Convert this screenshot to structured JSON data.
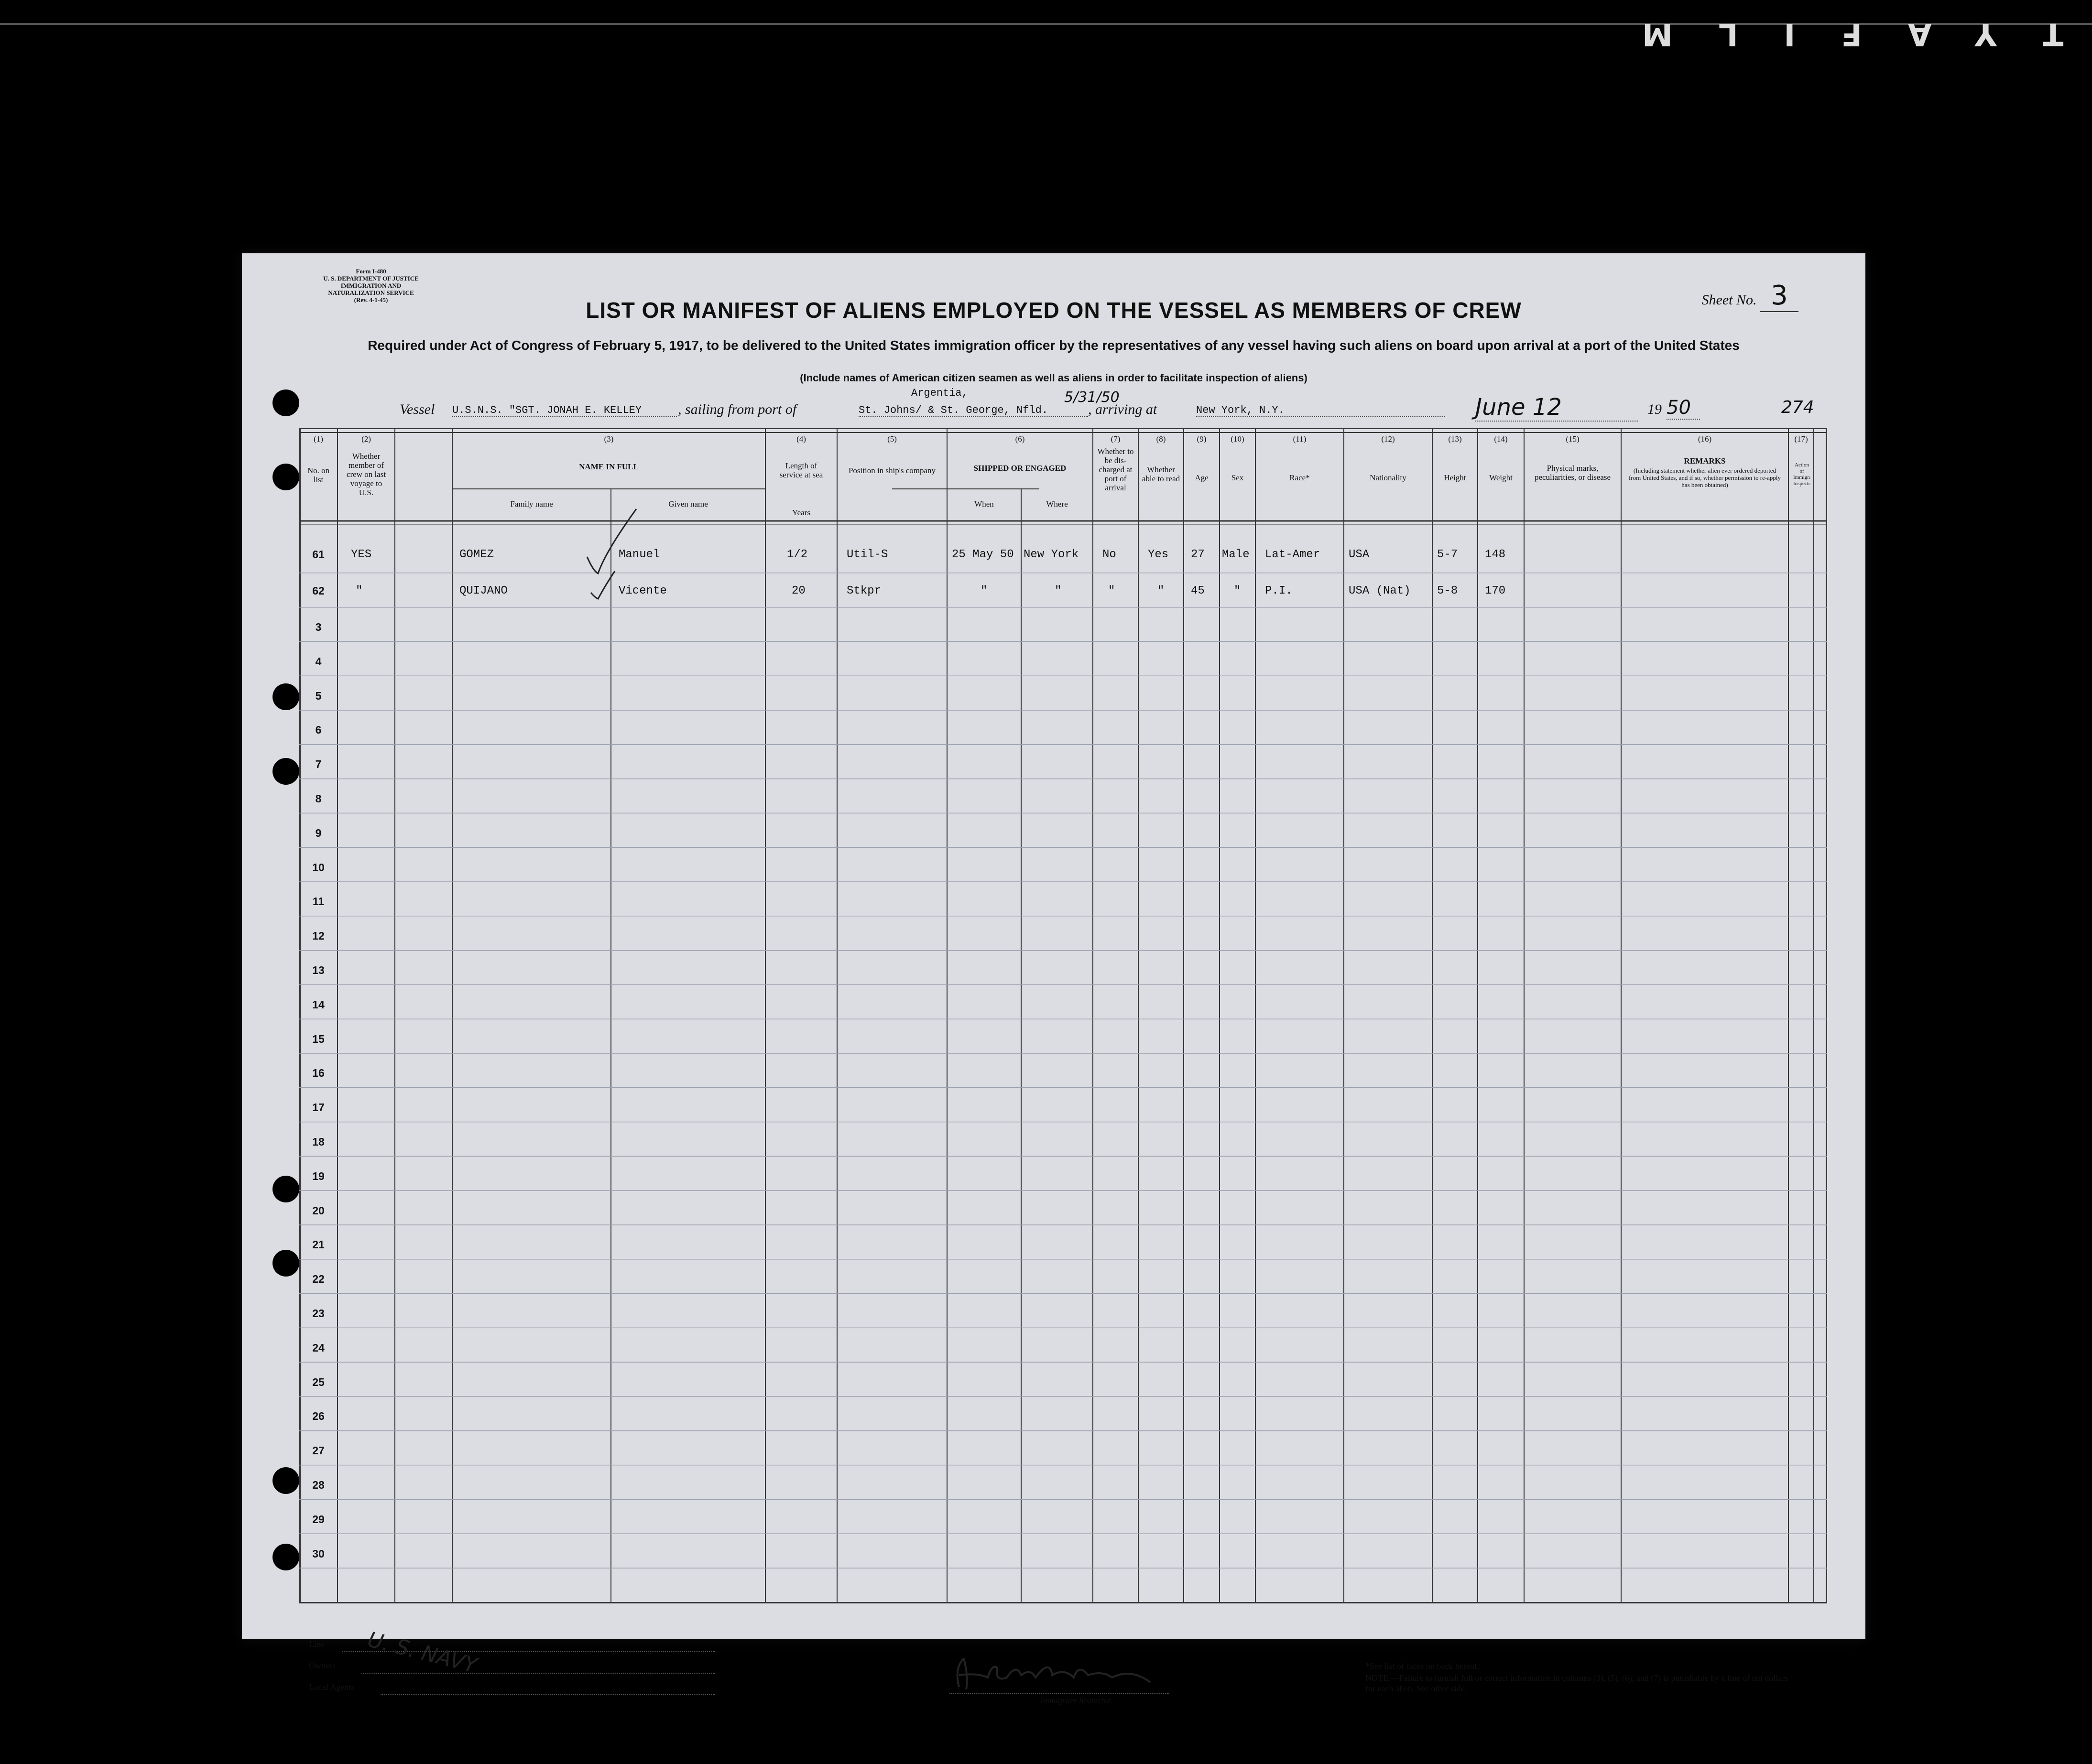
{
  "film": {
    "edge_text": "TYAFILM"
  },
  "form": {
    "form_id": "Form I-480",
    "department": "U. S. DEPARTMENT OF JUSTICE",
    "service": "IMMIGRATION AND NATURALIZATION SERVICE",
    "revision": "(Rev. 4-1-45)",
    "sheet_label": "Sheet No.",
    "sheet_value": "3",
    "title": "LIST OR MANIFEST OF ALIENS EMPLOYED ON THE VESSEL AS MEMBERS OF CREW",
    "subtitle": "Required under Act of Congress of February 5, 1917, to be delivered to the United States immigration officer by the representatives of any vessel having such aliens on board upon arrival at a port of the United States",
    "note": "(Include names of American citizen seamen as well as aliens in order to facilitate inspection of aliens)"
  },
  "vessel": {
    "vessel_label": "Vessel",
    "vessel_name": "U.S.N.S. \"SGT. JONAH E. KELLEY",
    "sailing_label": ", sailing from port of",
    "port_from": "St. Johns/ & St. George, Nfld.",
    "port_from_extra": "Argentia,",
    "sail_date": "5/31/50",
    "arriving_label": ", arriving at",
    "port_to": "New York, N.Y.",
    "arrival_date": "June 12",
    "year_prefix": "19",
    "year_suffix": "50",
    "page_number": "274"
  },
  "columns": {
    "c1": {
      "num": "(1)",
      "label": "No. on list"
    },
    "c2": {
      "num": "(2)",
      "label": "Whether member of crew on last voyage to U.S."
    },
    "c3": {
      "num": "(3)",
      "label": "NAME IN FULL",
      "family": "Family name",
      "given": "Given name"
    },
    "c4": {
      "num": "(4)",
      "label": "Length of service at sea",
      "unit": "Years"
    },
    "c5": {
      "num": "(5)",
      "label": "Position in ship's company"
    },
    "c6": {
      "num": "(6)",
      "label": "SHIPPED OR ENGAGED",
      "when": "When",
      "where": "Where"
    },
    "c7": {
      "num": "(7)",
      "label": "Whether to be dis-charged at port of arrival"
    },
    "c8": {
      "num": "(8)",
      "label": "Whether able to read"
    },
    "c9": {
      "num": "(9)",
      "label": "Age"
    },
    "c10": {
      "num": "(10)",
      "label": "Sex"
    },
    "c11": {
      "num": "(11)",
      "label": "Race*"
    },
    "c12": {
      "num": "(12)",
      "label": "Nationality"
    },
    "c13": {
      "num": "(13)",
      "label": "Height"
    },
    "c14": {
      "num": "(14)",
      "label": "Weight"
    },
    "c15": {
      "num": "(15)",
      "label": "Physical marks, peculiarities, or disease"
    },
    "c16": {
      "num": "(16)",
      "label": "REMARKS",
      "sub": "(Including statement whether alien ever ordered deported from United States, and if so, whether permission to re-apply has been obtained)"
    },
    "c17": {
      "num": "(17)",
      "label": "Action of Immigrant Inspector",
      "sub": "(This column for use of Government officials only)"
    }
  },
  "rows": [
    {
      "no": "61",
      "last_voyage": "YES",
      "family": "GOMEZ",
      "given": "Manuel",
      "service": "1/2",
      "position": "Util-S",
      "when": "25 May 50",
      "where": "New York",
      "discharged": "No",
      "read": "Yes",
      "age": "27",
      "sex": "Male",
      "race": "Lat-Amer",
      "nationality": "USA",
      "height": "5-7",
      "weight": "148"
    },
    {
      "no": "62",
      "last_voyage": "\"",
      "family": "QUIJANO",
      "given": "Vicente",
      "service": "20",
      "position": "Stkpr",
      "when": "\"",
      "where": "\"",
      "discharged": "\"",
      "read": "\"",
      "age": "45",
      "sex": "\"",
      "race": "P.I.",
      "nationality": "USA (Nat)",
      "height": "5-8",
      "weight": "170"
    }
  ],
  "row_numbers": [
    "3",
    "4",
    "5",
    "6",
    "7",
    "8",
    "9",
    "10",
    "11",
    "12",
    "13",
    "14",
    "15",
    "16",
    "17",
    "18",
    "19",
    "20",
    "21",
    "22",
    "23",
    "24",
    "25",
    "26",
    "27",
    "28",
    "29",
    "30"
  ],
  "footer": {
    "line_label": "Line",
    "owners_label": "Owners",
    "agents_label": "Local Agents",
    "owner_value": "U. S. NAVY",
    "inspector_label": "Immigrant Inspector.",
    "footnote_1": "*See list of races on back hereof.",
    "footnote_2": "NOTE.—Failure to furnish full or correct information in columns (3), (5), (6), and (7) is punishable by a fine of ten dollars for each alien. See other side."
  }
}
